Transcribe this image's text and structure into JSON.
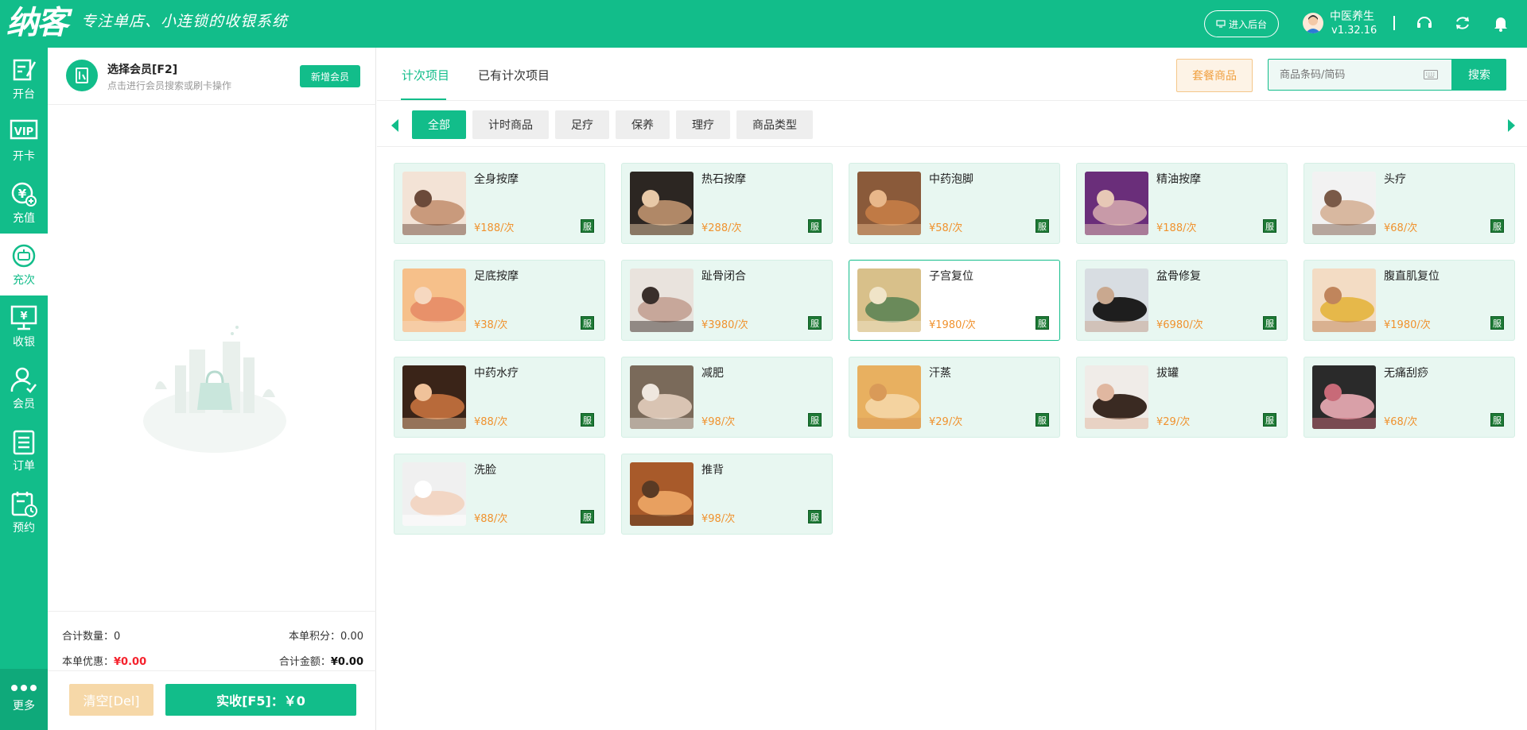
{
  "header": {
    "logo_text": "纳客",
    "slogan": "专注单店、小连锁的收银系统",
    "backend_label": "进入后台",
    "user_name": "中医养生",
    "version": "v1.32.16",
    "icons": [
      "support-icon",
      "refresh-icon",
      "bell-icon"
    ]
  },
  "nav": {
    "items": [
      {
        "label": "开台",
        "icon": "open-table-icon"
      },
      {
        "label": "开卡",
        "icon": "vip-card-icon"
      },
      {
        "label": "充值",
        "icon": "recharge-icon"
      },
      {
        "label": "充次",
        "icon": "recharge-count-icon",
        "active": true
      },
      {
        "label": "收银",
        "icon": "cashier-icon"
      },
      {
        "label": "会员",
        "icon": "member-icon"
      },
      {
        "label": "订单",
        "icon": "order-icon"
      },
      {
        "label": "预约",
        "icon": "appointment-icon"
      },
      {
        "label": "更多",
        "icon": "more-icon"
      }
    ]
  },
  "member": {
    "title": "选择会员[F2]",
    "hint": "点击进行会员搜索或刷卡操作",
    "add_label": "新增会员"
  },
  "totals": {
    "count_label": "合计数量：",
    "count_value": "0",
    "points_label": "本单积分：",
    "points_value": "0.00",
    "discount_label": "本单优惠：",
    "discount_value": "¥0.00",
    "amount_label": "合计金额：",
    "amount_value": "¥0.00"
  },
  "actions": {
    "clear_label": "清空[Del]",
    "pay_label": "实收[F5]：￥0"
  },
  "main": {
    "tabs": [
      {
        "label": "计次项目",
        "active": true
      },
      {
        "label": "已有计次项目",
        "active": false
      }
    ],
    "package_label": "套餐商品",
    "search_placeholder": "商品条码/简码",
    "search_label": "搜索",
    "categories": [
      {
        "label": "全部",
        "active": true
      },
      {
        "label": "计时商品"
      },
      {
        "label": "足疗"
      },
      {
        "label": "保养"
      },
      {
        "label": "理疗"
      },
      {
        "label": "商品类型"
      }
    ],
    "badge_label": "服",
    "products": [
      {
        "name": "全身按摩",
        "price": "¥188/次"
      },
      {
        "name": "热石按摩",
        "price": "¥288/次"
      },
      {
        "name": "中药泡脚",
        "price": "¥58/次"
      },
      {
        "name": "精油按摩",
        "price": "¥188/次"
      },
      {
        "name": "头疗",
        "price": "¥68/次"
      },
      {
        "name": "足底按摩",
        "price": "¥38/次"
      },
      {
        "name": "趾骨闭合",
        "price": "¥3980/次"
      },
      {
        "name": "子宫复位",
        "price": "¥1980/次",
        "selected": true
      },
      {
        "name": "盆骨修复",
        "price": "¥6980/次"
      },
      {
        "name": "腹直肌复位",
        "price": "¥1980/次"
      },
      {
        "name": "中药水疗",
        "price": "¥88/次"
      },
      {
        "name": "减肥",
        "price": "¥98/次"
      },
      {
        "name": "汗蒸",
        "price": "¥29/次"
      },
      {
        "name": "拔罐",
        "price": "¥29/次"
      },
      {
        "name": "无痛刮痧",
        "price": "¥68/次"
      },
      {
        "name": "洗脸",
        "price": "¥88/次"
      },
      {
        "name": "推背",
        "price": "¥98/次"
      }
    ]
  },
  "colors": {
    "brand": "#12bd8a",
    "price": "#f0922e",
    "discount": "#f5222d",
    "card_bg": "#e8f7f1"
  }
}
